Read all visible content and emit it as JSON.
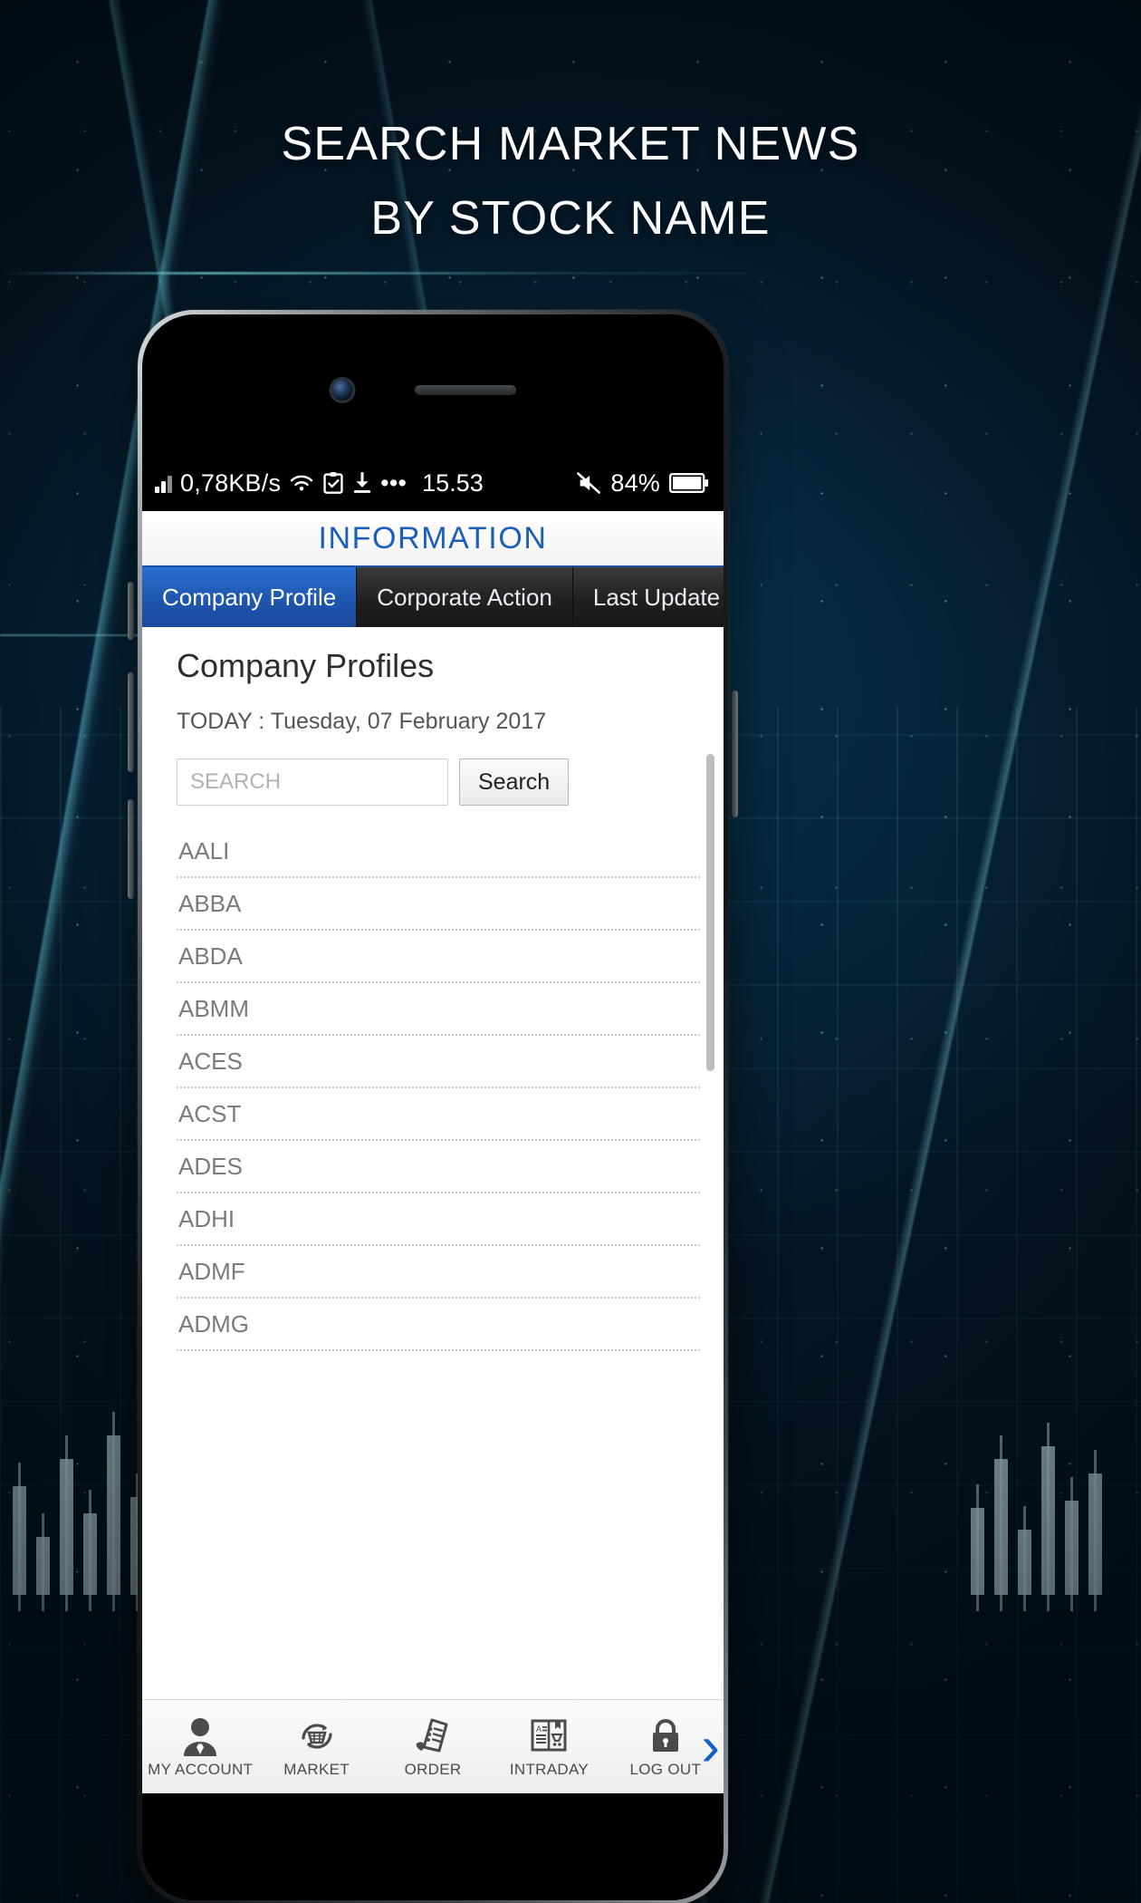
{
  "promo": {
    "headline_line1": "SEARCH MARKET NEWS",
    "headline_line2": "BY STOCK NAME"
  },
  "status_bar": {
    "network_speed": "0,78KB/s",
    "more_dots": "•••",
    "clock": "15.53",
    "battery_percent": "84%",
    "icons": {
      "signal": "signal-bars-icon",
      "wifi": "wifi-icon",
      "clipboard": "clipboard-check-icon",
      "download": "download-icon",
      "overflow": "more-dots-icon",
      "mute": "mute-icon",
      "battery": "battery-icon"
    }
  },
  "app": {
    "title": "INFORMATION",
    "tabs": [
      {
        "label": "Company Profile",
        "active": true
      },
      {
        "label": "Corporate Action",
        "active": false
      },
      {
        "label": "Last Update",
        "active": false
      }
    ],
    "content": {
      "heading": "Company Profiles",
      "today_line": "TODAY : Tuesday, 07 February 2017",
      "search": {
        "placeholder": "SEARCH",
        "value": "",
        "button_label": "Search"
      },
      "stock_list": [
        "AALI",
        "ABBA",
        "ABDA",
        "ABMM",
        "ACES",
        "ACST",
        "ADES",
        "ADHI",
        "ADMF",
        "ADMG"
      ]
    },
    "bottom_nav": [
      {
        "label": "MY ACCOUNT",
        "icon": "user-account-icon"
      },
      {
        "label": "MARKET",
        "icon": "market-basket-icon"
      },
      {
        "label": "ORDER",
        "icon": "order-list-icon"
      },
      {
        "label": "INTRADAY",
        "icon": "intraday-book-icon"
      },
      {
        "label": "LOG OUT",
        "icon": "padlock-icon"
      }
    ],
    "nav_next_glyph": "›"
  },
  "colors": {
    "accent_blue": "#1b5fbb",
    "tab_active": "#1f56ae",
    "nav_arrow": "#1761c4"
  }
}
